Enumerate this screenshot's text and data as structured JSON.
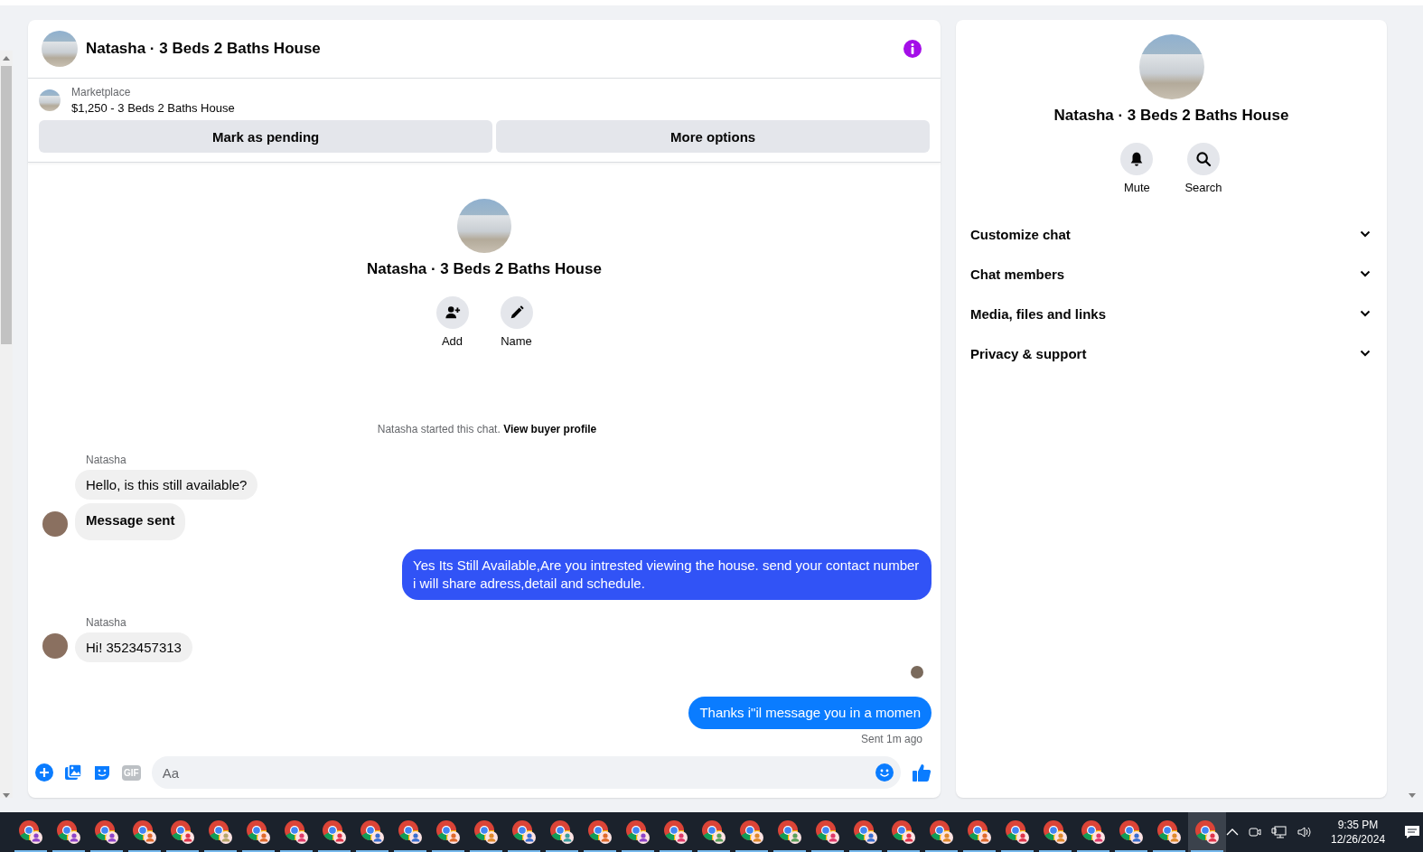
{
  "chat": {
    "title": "Natasha · 3 Beds 2 Baths House",
    "listing": {
      "source": "Marketplace",
      "name": "$1,250 - 3 Beds 2 Baths House"
    },
    "listing_buttons": [
      "Mark as pending",
      "More options"
    ],
    "intro": {
      "title": "Natasha · 3 Beds 2 Baths House",
      "actions": [
        {
          "kind": "add",
          "label": "Add"
        },
        {
          "kind": "name",
          "label": "Name"
        }
      ]
    },
    "started": {
      "text": "Natasha started this chat.",
      "link": "View buyer profile"
    },
    "messages": [
      {
        "kind": "sender",
        "text": "Natasha"
      },
      {
        "kind": "incoming",
        "text": "Hello, is this still available?",
        "avatar": false,
        "bold": false
      },
      {
        "kind": "incoming",
        "text": "Message sent",
        "avatar": true,
        "bold": true
      },
      {
        "kind": "outgoing",
        "text": "Yes Its Still Available,Are you intrested viewing the house. send your contact number i will share adress,detail and schedule.",
        "color": "#3153f6"
      },
      {
        "kind": "sender",
        "text": "Natasha"
      },
      {
        "kind": "incoming",
        "text": "Hi! 3523457313",
        "avatar": true,
        "bold": false
      },
      {
        "kind": "seen"
      },
      {
        "kind": "outgoing",
        "text": "Thanks i\"il message you in a momen",
        "color": "#0a7cff"
      },
      {
        "kind": "status",
        "text": "Sent 1m ago"
      }
    ],
    "composer": {
      "gif": "GIF",
      "placeholder": "Aa"
    }
  },
  "info": {
    "title": "Natasha · 3 Beds 2 Baths House",
    "actions": [
      {
        "kind": "mute",
        "label": "Mute"
      },
      {
        "kind": "search",
        "label": "Search"
      }
    ],
    "sections": [
      {
        "label": "Customize chat",
        "expanded": false
      },
      {
        "label": "Chat members",
        "expanded": false
      },
      {
        "label": "Media, files and links",
        "expanded": false
      },
      {
        "label": "Privacy & support",
        "expanded": false
      }
    ]
  },
  "taskbar": {
    "apps": [
      {
        "color": "#8e44c9",
        "selected": false
      },
      {
        "color": "#8e44c9",
        "selected": false
      },
      {
        "color": "#8e44c9",
        "selected": false
      },
      {
        "color": "#e06a2c",
        "selected": false
      },
      {
        "color": "#e0344a",
        "selected": false
      },
      {
        "color": "#b7a66a",
        "selected": false
      },
      {
        "color": "#e06a2c",
        "selected": false
      },
      {
        "color": "#e03a6a",
        "selected": false
      },
      {
        "color": "#e0344a",
        "selected": false
      },
      {
        "color": "#3a6fd0",
        "selected": false
      },
      {
        "color": "#3a6fd0",
        "selected": false
      },
      {
        "color": "#e06a2c",
        "selected": false
      },
      {
        "color": "#e08a2c",
        "selected": false
      },
      {
        "color": "#3a6fd0",
        "selected": false
      },
      {
        "color": "#3aa0a0",
        "selected": false
      },
      {
        "color": "#e06a2c",
        "selected": false
      },
      {
        "color": "#8e44c9",
        "selected": false
      },
      {
        "color": "#e03a6a",
        "selected": false
      },
      {
        "color": "#5aa05a",
        "selected": false
      },
      {
        "color": "#e08a2c",
        "selected": false
      },
      {
        "color": "#5aa05a",
        "selected": false
      },
      {
        "color": "#e03a6a",
        "selected": false
      },
      {
        "color": "#3a6fd0",
        "selected": false
      },
      {
        "color": "#e0344a",
        "selected": false
      },
      {
        "color": "#e08a2c",
        "selected": false
      },
      {
        "color": "#e06a2c",
        "selected": false
      },
      {
        "color": "#e0344a",
        "selected": false
      },
      {
        "color": "#e08a2c",
        "selected": false
      },
      {
        "color": "#e03a6a",
        "selected": false
      },
      {
        "color": "#3a6fd0",
        "selected": false
      },
      {
        "color": "#e08a2c",
        "selected": false
      },
      {
        "color": "#e0344a",
        "selected": true
      }
    ],
    "time": "9:35 PM",
    "date": "12/26/2024"
  }
}
